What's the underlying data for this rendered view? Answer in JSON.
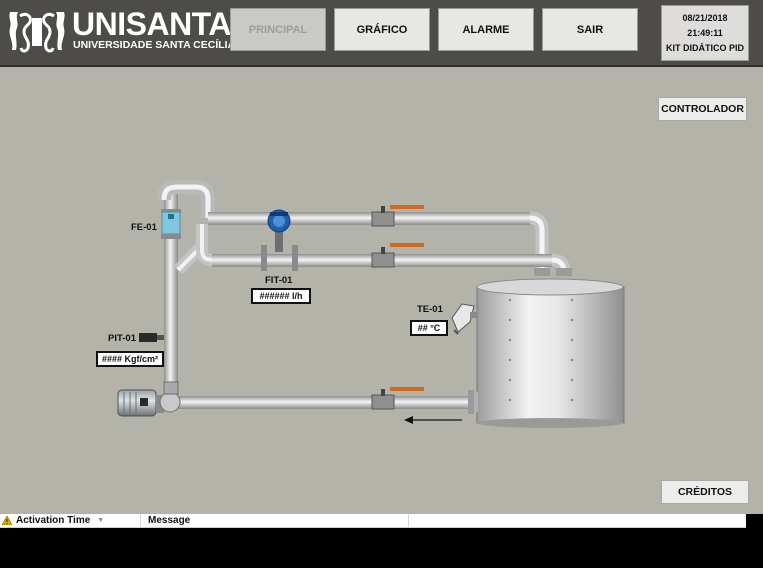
{
  "header": {
    "logo_title": "UNISANTA",
    "logo_subtitle": "UNIVERSIDADE SANTA CECÍLIA",
    "nav": [
      {
        "label": "PRINCIPAL"
      },
      {
        "label": "GRÁFICO"
      },
      {
        "label": "ALARME"
      },
      {
        "label": "SAIR"
      }
    ],
    "date": "08/21/2018",
    "time": "21:49:11",
    "kit": "KIT DIDÁTICO PID"
  },
  "buttons": {
    "controlador": "CONTROLADOR",
    "creditos": "CRÉDITOS"
  },
  "instruments": {
    "fe": {
      "tag": "FE-01"
    },
    "fit": {
      "tag": "FIT-01",
      "value": "###### l/h"
    },
    "te": {
      "tag": "TE-01",
      "value": "## °C"
    },
    "pit": {
      "tag": "PIT-01",
      "value": "#### Kgf/cm²"
    }
  },
  "alarm_table": {
    "col_activation": "Activation Time",
    "col_message": "Message"
  },
  "colors": {
    "header_bg": "#4d4c48",
    "canvas_bg": "#b4b3aa",
    "valve_handle": "#d2691e",
    "flow_meter_blue": "#1f5fb0"
  }
}
